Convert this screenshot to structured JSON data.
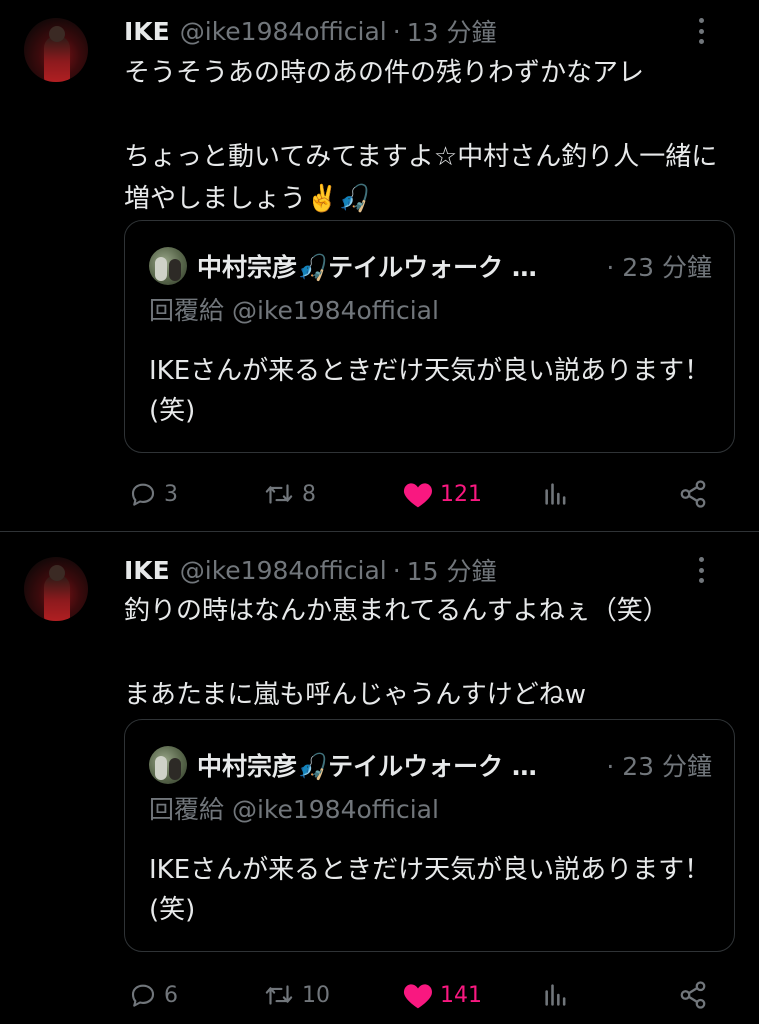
{
  "tweets": [
    {
      "author": {
        "name": "IKE",
        "handle": "@ike1984official"
      },
      "time": "13 分鐘",
      "text": "そうそうあの時のあの件の残りわずかなアレ\n\nちょっと動いてみてますよ☆中村さん釣り人一緒に増やしましょう✌️🎣",
      "quote": {
        "author_name": "中村宗彦🎣テイルウォーク …",
        "time": "· 23 分鐘",
        "reply_to": "回覆給 @ike1984official",
        "text": "IKEさんが来るときだけ天気が良い説あります！(笑)"
      },
      "stats": {
        "replies": "3",
        "retweets": "8",
        "likes": "121"
      }
    },
    {
      "author": {
        "name": "IKE",
        "handle": "@ike1984official"
      },
      "time": "15 分鐘",
      "text": "釣りの時はなんか恵まれてるんすよねぇ（笑）\n\nまあたまに嵐も呼んじゃうんすけどねw",
      "quote": {
        "author_name": "中村宗彦🎣テイルウォーク …",
        "time": "· 23 分鐘",
        "reply_to": "回覆給 @ike1984official",
        "text": "IKEさんが来るときだけ天気が良い説あります！(笑)"
      },
      "stats": {
        "replies": "6",
        "retweets": "10",
        "likes": "141"
      }
    }
  ],
  "colors": {
    "background": "#000000",
    "text": "#e7e9ea",
    "muted": "#71767b",
    "border": "#2f3336",
    "like": "#f91880"
  },
  "icons": [
    "more-icon",
    "reply-icon",
    "retweet-icon",
    "heart-icon",
    "views-icon",
    "share-icon"
  ]
}
